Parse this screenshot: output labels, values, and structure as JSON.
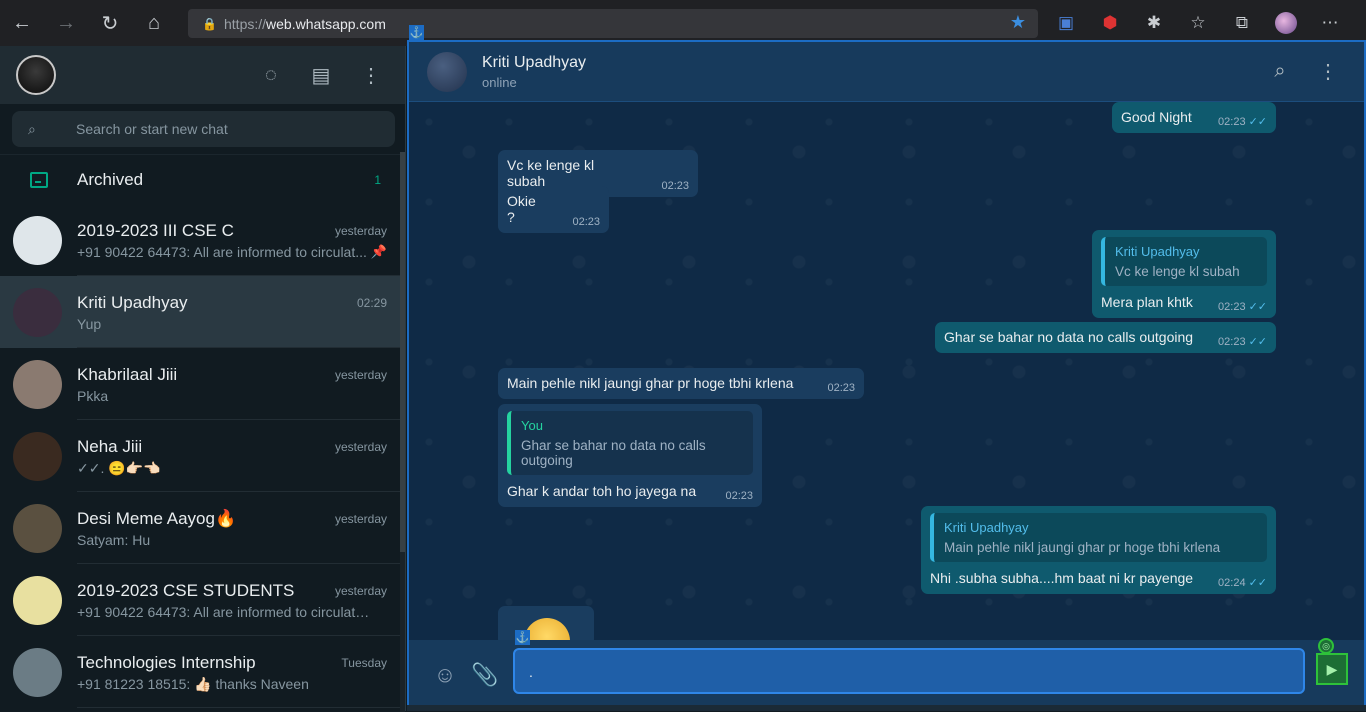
{
  "browser": {
    "url_protocol": "https://",
    "url_host": "web.whatsapp.com"
  },
  "search": {
    "placeholder": "Search or start new chat"
  },
  "archived": {
    "label": "Archived",
    "count": "1"
  },
  "chats": [
    {
      "name": "2019-2023 III CSE C",
      "time": "yesterday",
      "preview": "+91 90422 64473: All are informed to circulat...",
      "pinned": true,
      "avatar_color": "#dfe6ea"
    },
    {
      "name": "Kriti Upadhyay",
      "time": "02:29",
      "preview": "Yup",
      "active": true,
      "avatar_color": "#3a2d3e"
    },
    {
      "name": "Khabrilaal Jiii",
      "time": "yesterday",
      "preview": "Pkka",
      "avatar_color": "#8a7a70"
    },
    {
      "name": "Neha Jiii",
      "time": "yesterday",
      "preview": "✓✓. 😑👉🏻👈🏻",
      "avatar_color": "#3a2a20"
    },
    {
      "name": "Desi Meme Aayog🔥",
      "time": "yesterday",
      "preview": "Satyam: Hu",
      "avatar_color": "#5a5040"
    },
    {
      "name": "2019-2023 CSE STUDENTS",
      "time": "yesterday",
      "preview": "+91 90422 64473: All are informed to circulate ...",
      "avatar_color": "#e8e0a0"
    },
    {
      "name": "Technologies Internship",
      "time": "Tuesday",
      "preview": "+91 81223 18515: 👍🏻 thanks Naveen",
      "avatar_color": "#6b7c85"
    }
  ],
  "conversation": {
    "name": "Kriti Upadhyay",
    "status": "online",
    "messages": [
      {
        "dir": "out",
        "text": "Good Night",
        "time": "02:23"
      },
      {
        "dir": "in",
        "text": "Vc ke lenge kl subah",
        "time": "02:23"
      },
      {
        "dir": "in",
        "text": "Okie ?",
        "time": "02:23"
      },
      {
        "dir": "out",
        "quote_author": "Kriti Upadhyay",
        "quote_text": "Vc ke lenge kl subah",
        "text": "Mera plan khtk",
        "time": "02:23"
      },
      {
        "dir": "out",
        "text": "Ghar se bahar no data no calls outgoing",
        "time": "02:23"
      },
      {
        "dir": "in",
        "text": "Main pehle nikl jaungi ghar pr hoge tbhi krlena",
        "time": "02:23"
      },
      {
        "dir": "in",
        "quote_author": "You",
        "quote_text": "Ghar se bahar no data no calls outgoing",
        "text": "Ghar k andar toh ho jayega na",
        "time": "02:23"
      },
      {
        "dir": "out",
        "quote_author": "Kriti Upadhyay",
        "quote_text": "Main pehle nikl jaungi ghar pr hoge tbhi krlena",
        "text": "Nhi  .subha subha....hm baat ni kr payenge",
        "time": "02:24"
      }
    ]
  },
  "composer": {
    "value": "."
  },
  "colors": {
    "accent": "#00a884",
    "selection": "#1c6cc4",
    "ticks": "#53bdeb"
  }
}
